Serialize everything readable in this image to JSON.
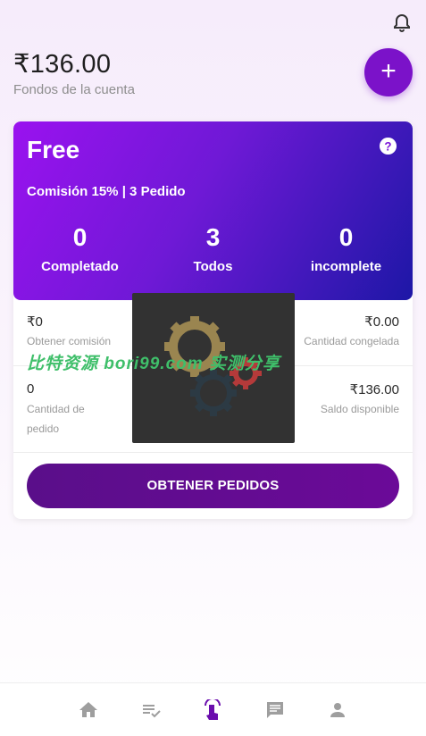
{
  "header": {
    "balance": "₹136.00",
    "balance_label": "Fondos de la cuenta",
    "add_label": "+"
  },
  "plan": {
    "title": "Free",
    "commission": "Comisión 15% | 3 Pedido",
    "stats": [
      {
        "value": "0",
        "label": "Completado"
      },
      {
        "value": "3",
        "label": "Todos"
      },
      {
        "value": "0",
        "label": "incomplete"
      }
    ]
  },
  "details": {
    "commission_value": "₹0",
    "commission_label": "Obtener comisión",
    "frozen_value": "₹0.00",
    "frozen_label": "Cantidad congelada",
    "orders_value": "0",
    "orders_label_1": "Cantidad de",
    "orders_label_2": "pedido",
    "available_value": "₹136.00",
    "available_label": "Saldo disponible"
  },
  "actions": {
    "get_orders": "OBTENER PEDIDOS"
  },
  "watermark": "比特资源 bori99.com 实测分享",
  "colors": {
    "accent": "#7b12c9",
    "button": "#5a0e8a",
    "nav_active": "#6a0dad",
    "nav_inactive": "#9e9e9e"
  },
  "icons": [
    "bell-icon",
    "help-icon",
    "home-icon",
    "orders-list-icon",
    "tap-icon",
    "chat-icon",
    "profile-icon"
  ],
  "bottom_nav": {
    "active_index": 2
  }
}
